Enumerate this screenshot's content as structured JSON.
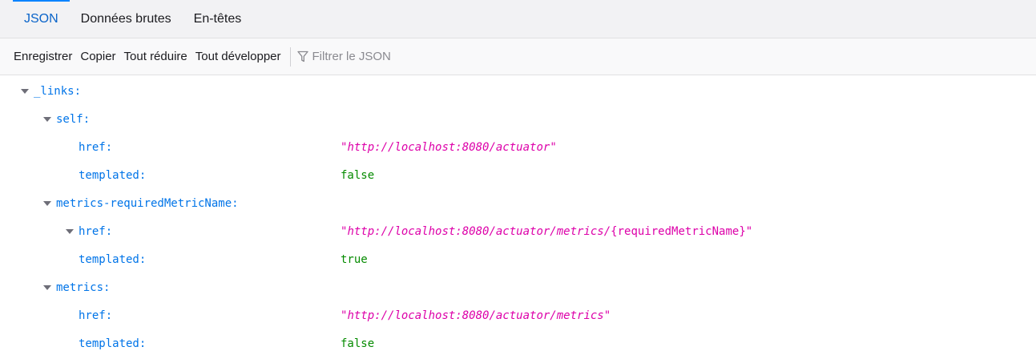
{
  "tabs": [
    {
      "label": "JSON",
      "active": true
    },
    {
      "label": "Données brutes",
      "active": false
    },
    {
      "label": "En-têtes",
      "active": false
    }
  ],
  "toolbar": {
    "save": "Enregistrer",
    "copy": "Copier",
    "collapse_all": "Tout réduire",
    "expand_all": "Tout développer",
    "filter_placeholder": "Filtrer le JSON"
  },
  "tree": {
    "root_key": "_links:",
    "self": {
      "key": "self:",
      "href_key": "href:",
      "href_value": "http://localhost:8080/actuator",
      "templated_key": "templated:",
      "templated_value": "false"
    },
    "metrics_required": {
      "key": "metrics-requiredMetricName:",
      "href_key": "href:",
      "href_value": "http://localhost:8080/actuator/metrics/",
      "href_value_tail": "{requiredMetricName}",
      "templated_key": "templated:",
      "templated_value": "true"
    },
    "metrics": {
      "key": "metrics:",
      "href_key": "href:",
      "href_value": "http://localhost:8080/actuator/metrics",
      "templated_key": "templated:",
      "templated_value": "false"
    }
  },
  "colors": {
    "accent": "#0a84ff",
    "key": "#0074e8",
    "string": "#dd00a9",
    "boolean": "#058b00"
  }
}
